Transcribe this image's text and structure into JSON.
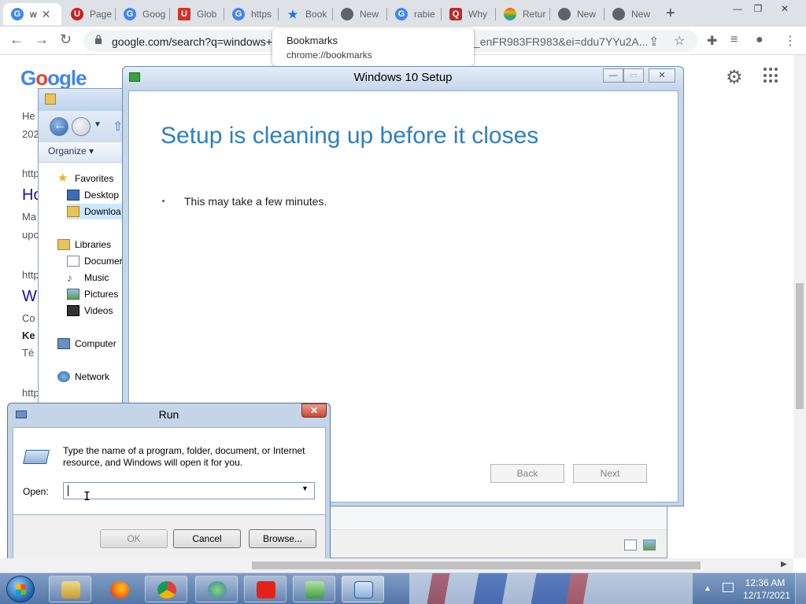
{
  "browser": {
    "tabs": [
      {
        "label": "w",
        "icon": "google-icon",
        "active": true
      },
      {
        "label": "Page",
        "icon": "ublock-icon"
      },
      {
        "label": "Goog",
        "icon": "google-icon"
      },
      {
        "label": "Glob",
        "icon": "unaids-icon"
      },
      {
        "label": "https",
        "icon": "google-icon"
      },
      {
        "label": "Book",
        "icon": "star-icon"
      },
      {
        "label": "New",
        "icon": "chrome-icon"
      },
      {
        "label": "rabie",
        "icon": "google-icon"
      },
      {
        "label": "Why",
        "icon": "quora-icon"
      },
      {
        "label": "Retur",
        "icon": "rainbow-icon"
      },
      {
        "label": "New",
        "icon": "chrome-icon"
      },
      {
        "label": "New",
        "icon": "chrome-icon"
      }
    ],
    "tab_close": "✕",
    "new_tab": "+",
    "url_start": "google.com/search?q=windows+",
    "url_end": "_enFR983FR983&ei=ddu7YYu2A...",
    "bookmark_tooltip": {
      "title": "Bookmarks",
      "url": "chrome://bookmarks"
    },
    "colors": {
      "tabstrip": "#dee1e6",
      "google_blue": "#4285f4"
    }
  },
  "google_page": {
    "logo": "Google",
    "snippets": [
      {
        "text": "He",
        "style": "normal"
      },
      {
        "text": "202",
        "style": "normal"
      },
      {
        "text": "http",
        "style": "normal"
      },
      {
        "text": "Ho",
        "style": "big"
      },
      {
        "text": "Ma",
        "style": "normal"
      },
      {
        "text": "upo",
        "style": "normal"
      },
      {
        "text": "http",
        "style": "normal"
      },
      {
        "text": "Wi",
        "style": "big"
      },
      {
        "text": "Co",
        "style": "normal"
      },
      {
        "text": "Ke",
        "style": "b"
      },
      {
        "text": "Té",
        "style": "normal"
      },
      {
        "text": "http",
        "style": "normal"
      }
    ]
  },
  "explorer": {
    "organize": "Organize ▾",
    "nav": {
      "favorites": "Favorites",
      "desktop": "Desktop",
      "downloads": "Downloa",
      "libraries": "Libraries",
      "documents": "Documer",
      "music": "Music",
      "pictures": "Pictures",
      "videos": "Videos",
      "computer": "Computer",
      "network": "Network"
    }
  },
  "setup": {
    "title": "Windows 10 Setup",
    "heading": "Setup is cleaning up before it closes",
    "message": "This may take a few minutes.",
    "back": "Back",
    "next": "Next",
    "colors": {
      "heading": "#2f7fbf"
    }
  },
  "run": {
    "title": "Run",
    "close": "✕",
    "description": "Type the name of a program, folder, document, or Internet resource, and Windows will open it for you.",
    "open_label": "Open:",
    "open_value": "",
    "ok": "OK",
    "cancel": "Cancel",
    "browse": "Browse..."
  },
  "taskbar": {
    "apps": [
      "explorer-icon",
      "firefox-icon",
      "chrome-icon",
      "globe-download-icon",
      "youtube-icon",
      "setup-icon",
      "run-icon"
    ],
    "clock_time": "12:36 AM",
    "clock_date": "12/17/2021"
  }
}
